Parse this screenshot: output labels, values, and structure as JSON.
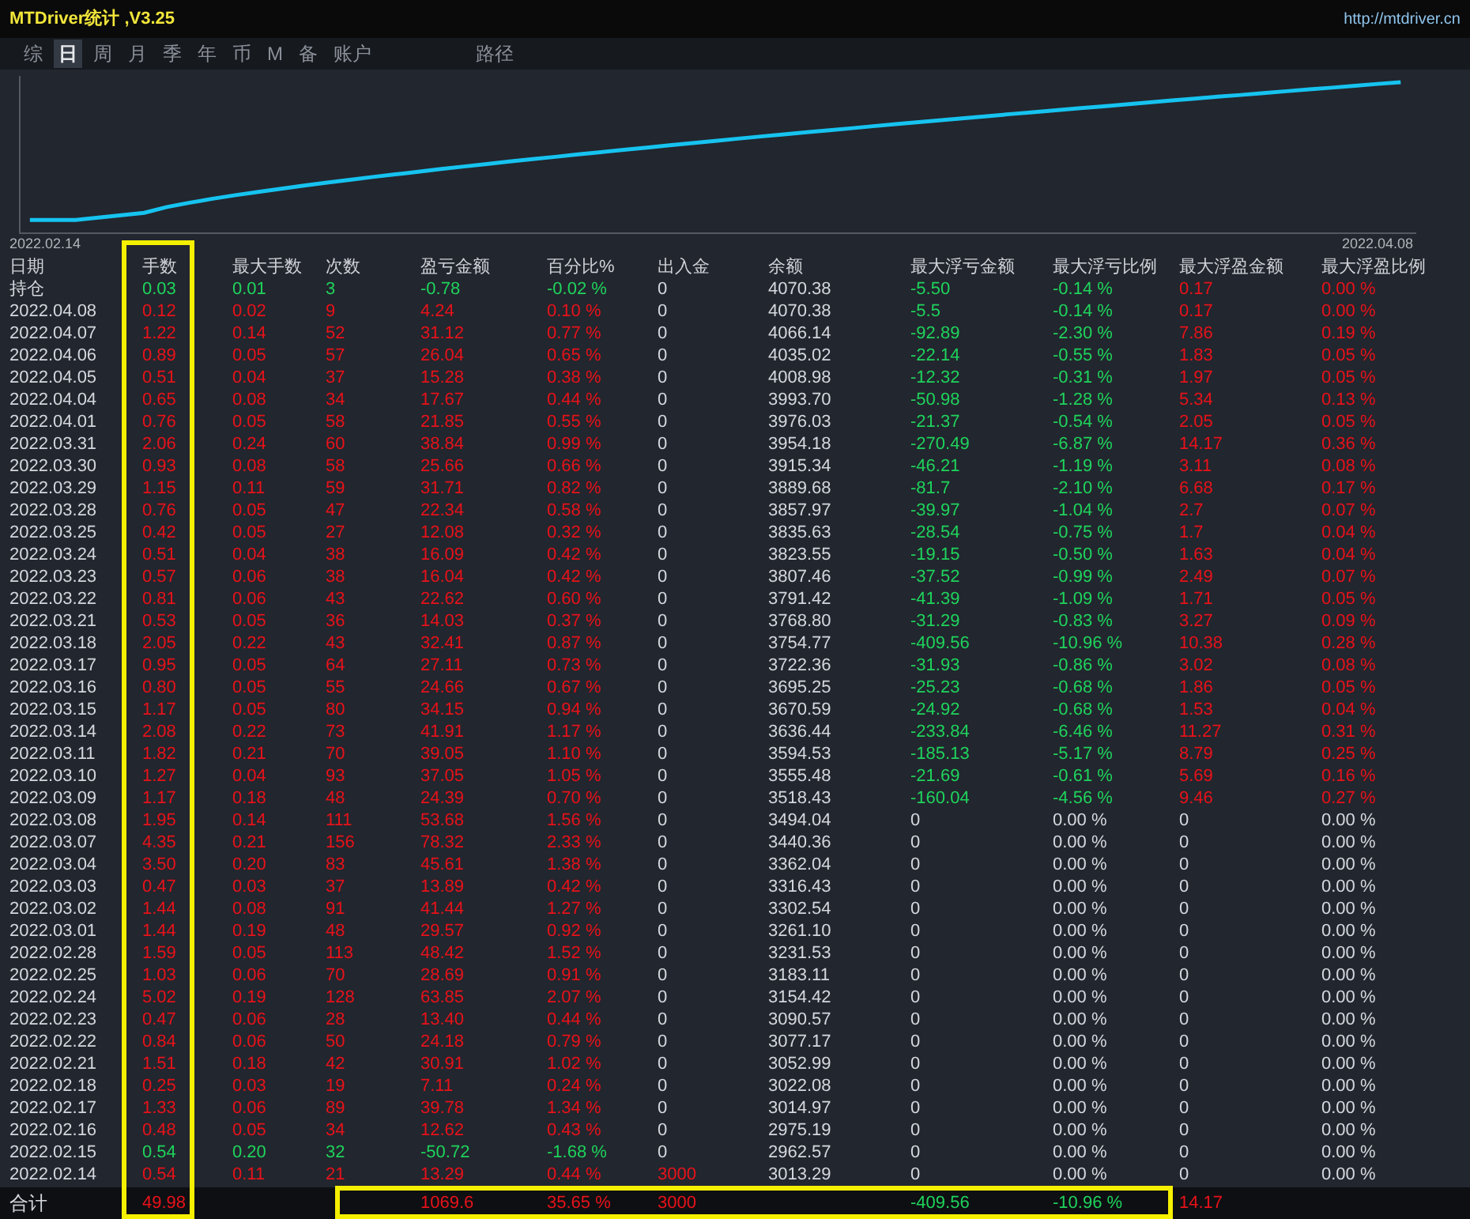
{
  "window": {
    "title": "MTDriver统计 ,V3.25",
    "url": "http://mtdriver.cn"
  },
  "tabs": [
    {
      "label": "综",
      "selected": false
    },
    {
      "label": "日",
      "selected": true
    },
    {
      "label": "周",
      "selected": false
    },
    {
      "label": "月",
      "selected": false
    },
    {
      "label": "季",
      "selected": false
    },
    {
      "label": "年",
      "selected": false
    },
    {
      "label": "币",
      "selected": false
    },
    {
      "label": "M",
      "selected": false
    },
    {
      "label": "备",
      "selected": false
    },
    {
      "label": "账户",
      "selected": false
    },
    {
      "label": "路径",
      "selected": false
    }
  ],
  "chart": {
    "start_label": "2022.02.14",
    "end_label": "2022.04.08"
  },
  "table": {
    "columns": [
      "日期",
      "手数",
      "最大手数",
      "次数",
      "盈亏金额",
      "百分比%",
      "出入金",
      "余额",
      "最大浮亏金额",
      "最大浮亏比例",
      "最大浮盈金额",
      "最大浮盈比例"
    ],
    "rows": [
      {
        "cells": [
          "持仓",
          "0.03",
          "0.01",
          "3",
          "-0.78",
          "-0.02 %",
          "0",
          "4070.38",
          "-5.50",
          "-0.14 %",
          "0.17",
          "0.00 %"
        ],
        "loss": true,
        "floating": true,
        "deposit_marked": false
      },
      {
        "cells": [
          "2022.04.08",
          "0.12",
          "0.02",
          "9",
          "4.24",
          "0.10 %",
          "0",
          "4070.38",
          "-5.5",
          "-0.14 %",
          "0.17",
          "0.00 %"
        ],
        "loss": false,
        "floating": true,
        "deposit_marked": false
      },
      {
        "cells": [
          "2022.04.07",
          "1.22",
          "0.14",
          "52",
          "31.12",
          "0.77 %",
          "0",
          "4066.14",
          "-92.89",
          "-2.30 %",
          "7.86",
          "0.19 %"
        ],
        "loss": false,
        "floating": true,
        "deposit_marked": false
      },
      {
        "cells": [
          "2022.04.06",
          "0.89",
          "0.05",
          "57",
          "26.04",
          "0.65 %",
          "0",
          "4035.02",
          "-22.14",
          "-0.55 %",
          "1.83",
          "0.05 %"
        ],
        "loss": false,
        "floating": true,
        "deposit_marked": false
      },
      {
        "cells": [
          "2022.04.05",
          "0.51",
          "0.04",
          "37",
          "15.28",
          "0.38 %",
          "0",
          "4008.98",
          "-12.32",
          "-0.31 %",
          "1.97",
          "0.05 %"
        ],
        "loss": false,
        "floating": true,
        "deposit_marked": false
      },
      {
        "cells": [
          "2022.04.04",
          "0.65",
          "0.08",
          "34",
          "17.67",
          "0.44 %",
          "0",
          "3993.70",
          "-50.98",
          "-1.28 %",
          "5.34",
          "0.13 %"
        ],
        "loss": false,
        "floating": true,
        "deposit_marked": false
      },
      {
        "cells": [
          "2022.04.01",
          "0.76",
          "0.05",
          "58",
          "21.85",
          "0.55 %",
          "0",
          "3976.03",
          "-21.37",
          "-0.54 %",
          "2.05",
          "0.05 %"
        ],
        "loss": false,
        "floating": true,
        "deposit_marked": false
      },
      {
        "cells": [
          "2022.03.31",
          "2.06",
          "0.24",
          "60",
          "38.84",
          "0.99 %",
          "0",
          "3954.18",
          "-270.49",
          "-6.87 %",
          "14.17",
          "0.36 %"
        ],
        "loss": false,
        "floating": true,
        "deposit_marked": false
      },
      {
        "cells": [
          "2022.03.30",
          "0.93",
          "0.08",
          "58",
          "25.66",
          "0.66 %",
          "0",
          "3915.34",
          "-46.21",
          "-1.19 %",
          "3.11",
          "0.08 %"
        ],
        "loss": false,
        "floating": true,
        "deposit_marked": false
      },
      {
        "cells": [
          "2022.03.29",
          "1.15",
          "0.11",
          "59",
          "31.71",
          "0.82 %",
          "0",
          "3889.68",
          "-81.7",
          "-2.10 %",
          "6.68",
          "0.17 %"
        ],
        "loss": false,
        "floating": true,
        "deposit_marked": false
      },
      {
        "cells": [
          "2022.03.28",
          "0.76",
          "0.05",
          "47",
          "22.34",
          "0.58 %",
          "0",
          "3857.97",
          "-39.97",
          "-1.04 %",
          "2.7",
          "0.07 %"
        ],
        "loss": false,
        "floating": true,
        "deposit_marked": false
      },
      {
        "cells": [
          "2022.03.25",
          "0.42",
          "0.05",
          "27",
          "12.08",
          "0.32 %",
          "0",
          "3835.63",
          "-28.54",
          "-0.75 %",
          "1.7",
          "0.04 %"
        ],
        "loss": false,
        "floating": true,
        "deposit_marked": false
      },
      {
        "cells": [
          "2022.03.24",
          "0.51",
          "0.04",
          "38",
          "16.09",
          "0.42 %",
          "0",
          "3823.55",
          "-19.15",
          "-0.50 %",
          "1.63",
          "0.04 %"
        ],
        "loss": false,
        "floating": true,
        "deposit_marked": false
      },
      {
        "cells": [
          "2022.03.23",
          "0.57",
          "0.06",
          "38",
          "16.04",
          "0.42 %",
          "0",
          "3807.46",
          "-37.52",
          "-0.99 %",
          "2.49",
          "0.07 %"
        ],
        "loss": false,
        "floating": true,
        "deposit_marked": false
      },
      {
        "cells": [
          "2022.03.22",
          "0.81",
          "0.06",
          "43",
          "22.62",
          "0.60 %",
          "0",
          "3791.42",
          "-41.39",
          "-1.09 %",
          "1.71",
          "0.05 %"
        ],
        "loss": false,
        "floating": true,
        "deposit_marked": false
      },
      {
        "cells": [
          "2022.03.21",
          "0.53",
          "0.05",
          "36",
          "14.03",
          "0.37 %",
          "0",
          "3768.80",
          "-31.29",
          "-0.83 %",
          "3.27",
          "0.09 %"
        ],
        "loss": false,
        "floating": true,
        "deposit_marked": false
      },
      {
        "cells": [
          "2022.03.18",
          "2.05",
          "0.22",
          "43",
          "32.41",
          "0.87 %",
          "0",
          "3754.77",
          "-409.56",
          "-10.96 %",
          "10.38",
          "0.28 %"
        ],
        "loss": false,
        "floating": true,
        "deposit_marked": false
      },
      {
        "cells": [
          "2022.03.17",
          "0.95",
          "0.05",
          "64",
          "27.11",
          "0.73 %",
          "0",
          "3722.36",
          "-31.93",
          "-0.86 %",
          "3.02",
          "0.08 %"
        ],
        "loss": false,
        "floating": true,
        "deposit_marked": false
      },
      {
        "cells": [
          "2022.03.16",
          "0.80",
          "0.05",
          "55",
          "24.66",
          "0.67 %",
          "0",
          "3695.25",
          "-25.23",
          "-0.68 %",
          "1.86",
          "0.05 %"
        ],
        "loss": false,
        "floating": true,
        "deposit_marked": false
      },
      {
        "cells": [
          "2022.03.15",
          "1.17",
          "0.05",
          "80",
          "34.15",
          "0.94 %",
          "0",
          "3670.59",
          "-24.92",
          "-0.68 %",
          "1.53",
          "0.04 %"
        ],
        "loss": false,
        "floating": true,
        "deposit_marked": false
      },
      {
        "cells": [
          "2022.03.14",
          "2.08",
          "0.22",
          "73",
          "41.91",
          "1.17 %",
          "0",
          "3636.44",
          "-233.84",
          "-6.46 %",
          "11.27",
          "0.31 %"
        ],
        "loss": false,
        "floating": true,
        "deposit_marked": false
      },
      {
        "cells": [
          "2022.03.11",
          "1.82",
          "0.21",
          "70",
          "39.05",
          "1.10 %",
          "0",
          "3594.53",
          "-185.13",
          "-5.17 %",
          "8.79",
          "0.25 %"
        ],
        "loss": false,
        "floating": true,
        "deposit_marked": false
      },
      {
        "cells": [
          "2022.03.10",
          "1.27",
          "0.04",
          "93",
          "37.05",
          "1.05 %",
          "0",
          "3555.48",
          "-21.69",
          "-0.61 %",
          "5.69",
          "0.16 %"
        ],
        "loss": false,
        "floating": true,
        "deposit_marked": false
      },
      {
        "cells": [
          "2022.03.09",
          "1.17",
          "0.18",
          "48",
          "24.39",
          "0.70 %",
          "0",
          "3518.43",
          "-160.04",
          "-4.56 %",
          "9.46",
          "0.27 %"
        ],
        "loss": false,
        "floating": true,
        "deposit_marked": false
      },
      {
        "cells": [
          "2022.03.08",
          "1.95",
          "0.14",
          "111",
          "53.68",
          "1.56 %",
          "0",
          "3494.04",
          "0",
          "0.00 %",
          "0",
          "0.00 %"
        ],
        "loss": false,
        "floating": false,
        "deposit_marked": false
      },
      {
        "cells": [
          "2022.03.07",
          "4.35",
          "0.21",
          "156",
          "78.32",
          "2.33 %",
          "0",
          "3440.36",
          "0",
          "0.00 %",
          "0",
          "0.00 %"
        ],
        "loss": false,
        "floating": false,
        "deposit_marked": false
      },
      {
        "cells": [
          "2022.03.04",
          "3.50",
          "0.20",
          "83",
          "45.61",
          "1.38 %",
          "0",
          "3362.04",
          "0",
          "0.00 %",
          "0",
          "0.00 %"
        ],
        "loss": false,
        "floating": false,
        "deposit_marked": false
      },
      {
        "cells": [
          "2022.03.03",
          "0.47",
          "0.03",
          "37",
          "13.89",
          "0.42 %",
          "0",
          "3316.43",
          "0",
          "0.00 %",
          "0",
          "0.00 %"
        ],
        "loss": false,
        "floating": false,
        "deposit_marked": false
      },
      {
        "cells": [
          "2022.03.02",
          "1.44",
          "0.08",
          "91",
          "41.44",
          "1.27 %",
          "0",
          "3302.54",
          "0",
          "0.00 %",
          "0",
          "0.00 %"
        ],
        "loss": false,
        "floating": false,
        "deposit_marked": false
      },
      {
        "cells": [
          "2022.03.01",
          "1.44",
          "0.19",
          "48",
          "29.57",
          "0.92 %",
          "0",
          "3261.10",
          "0",
          "0.00 %",
          "0",
          "0.00 %"
        ],
        "loss": false,
        "floating": false,
        "deposit_marked": false
      },
      {
        "cells": [
          "2022.02.28",
          "1.59",
          "0.05",
          "113",
          "48.42",
          "1.52 %",
          "0",
          "3231.53",
          "0",
          "0.00 %",
          "0",
          "0.00 %"
        ],
        "loss": false,
        "floating": false,
        "deposit_marked": false
      },
      {
        "cells": [
          "2022.02.25",
          "1.03",
          "0.06",
          "70",
          "28.69",
          "0.91 %",
          "0",
          "3183.11",
          "0",
          "0.00 %",
          "0",
          "0.00 %"
        ],
        "loss": false,
        "floating": false,
        "deposit_marked": false
      },
      {
        "cells": [
          "2022.02.24",
          "5.02",
          "0.19",
          "128",
          "63.85",
          "2.07 %",
          "0",
          "3154.42",
          "0",
          "0.00 %",
          "0",
          "0.00 %"
        ],
        "loss": false,
        "floating": false,
        "deposit_marked": false
      },
      {
        "cells": [
          "2022.02.23",
          "0.47",
          "0.06",
          "28",
          "13.40",
          "0.44 %",
          "0",
          "3090.57",
          "0",
          "0.00 %",
          "0",
          "0.00 %"
        ],
        "loss": false,
        "floating": false,
        "deposit_marked": false
      },
      {
        "cells": [
          "2022.02.22",
          "0.84",
          "0.06",
          "50",
          "24.18",
          "0.79 %",
          "0",
          "3077.17",
          "0",
          "0.00 %",
          "0",
          "0.00 %"
        ],
        "loss": false,
        "floating": false,
        "deposit_marked": false
      },
      {
        "cells": [
          "2022.02.21",
          "1.51",
          "0.18",
          "42",
          "30.91",
          "1.02 %",
          "0",
          "3052.99",
          "0",
          "0.00 %",
          "0",
          "0.00 %"
        ],
        "loss": false,
        "floating": false,
        "deposit_marked": false
      },
      {
        "cells": [
          "2022.02.18",
          "0.25",
          "0.03",
          "19",
          "7.11",
          "0.24 %",
          "0",
          "3022.08",
          "0",
          "0.00 %",
          "0",
          "0.00 %"
        ],
        "loss": false,
        "floating": false,
        "deposit_marked": false
      },
      {
        "cells": [
          "2022.02.17",
          "1.33",
          "0.06",
          "89",
          "39.78",
          "1.34 %",
          "0",
          "3014.97",
          "0",
          "0.00 %",
          "0",
          "0.00 %"
        ],
        "loss": false,
        "floating": false,
        "deposit_marked": false
      },
      {
        "cells": [
          "2022.02.16",
          "0.48",
          "0.05",
          "34",
          "12.62",
          "0.43 %",
          "0",
          "2975.19",
          "0",
          "0.00 %",
          "0",
          "0.00 %"
        ],
        "loss": false,
        "floating": false,
        "deposit_marked": false
      },
      {
        "cells": [
          "2022.02.15",
          "0.54",
          "0.20",
          "32",
          "-50.72",
          "-1.68 %",
          "0",
          "2962.57",
          "0",
          "0.00 %",
          "0",
          "0.00 %"
        ],
        "loss": true,
        "floating": false,
        "deposit_marked": false
      },
      {
        "cells": [
          "2022.02.14",
          "0.54",
          "0.11",
          "21",
          "13.29",
          "0.44 %",
          "3000",
          "3013.29",
          "0",
          "0.00 %",
          "0",
          "0.00 %"
        ],
        "loss": false,
        "floating": false,
        "deposit_marked": true
      }
    ],
    "totals": {
      "label": "合计",
      "lots": "49.98",
      "pnl": "1069.6",
      "pct": "35.65 %",
      "deposit": "3000",
      "max_float_loss": "-409.56",
      "max_float_loss_pct": "-10.96 %",
      "max_float_profit": "14.17"
    }
  }
}
